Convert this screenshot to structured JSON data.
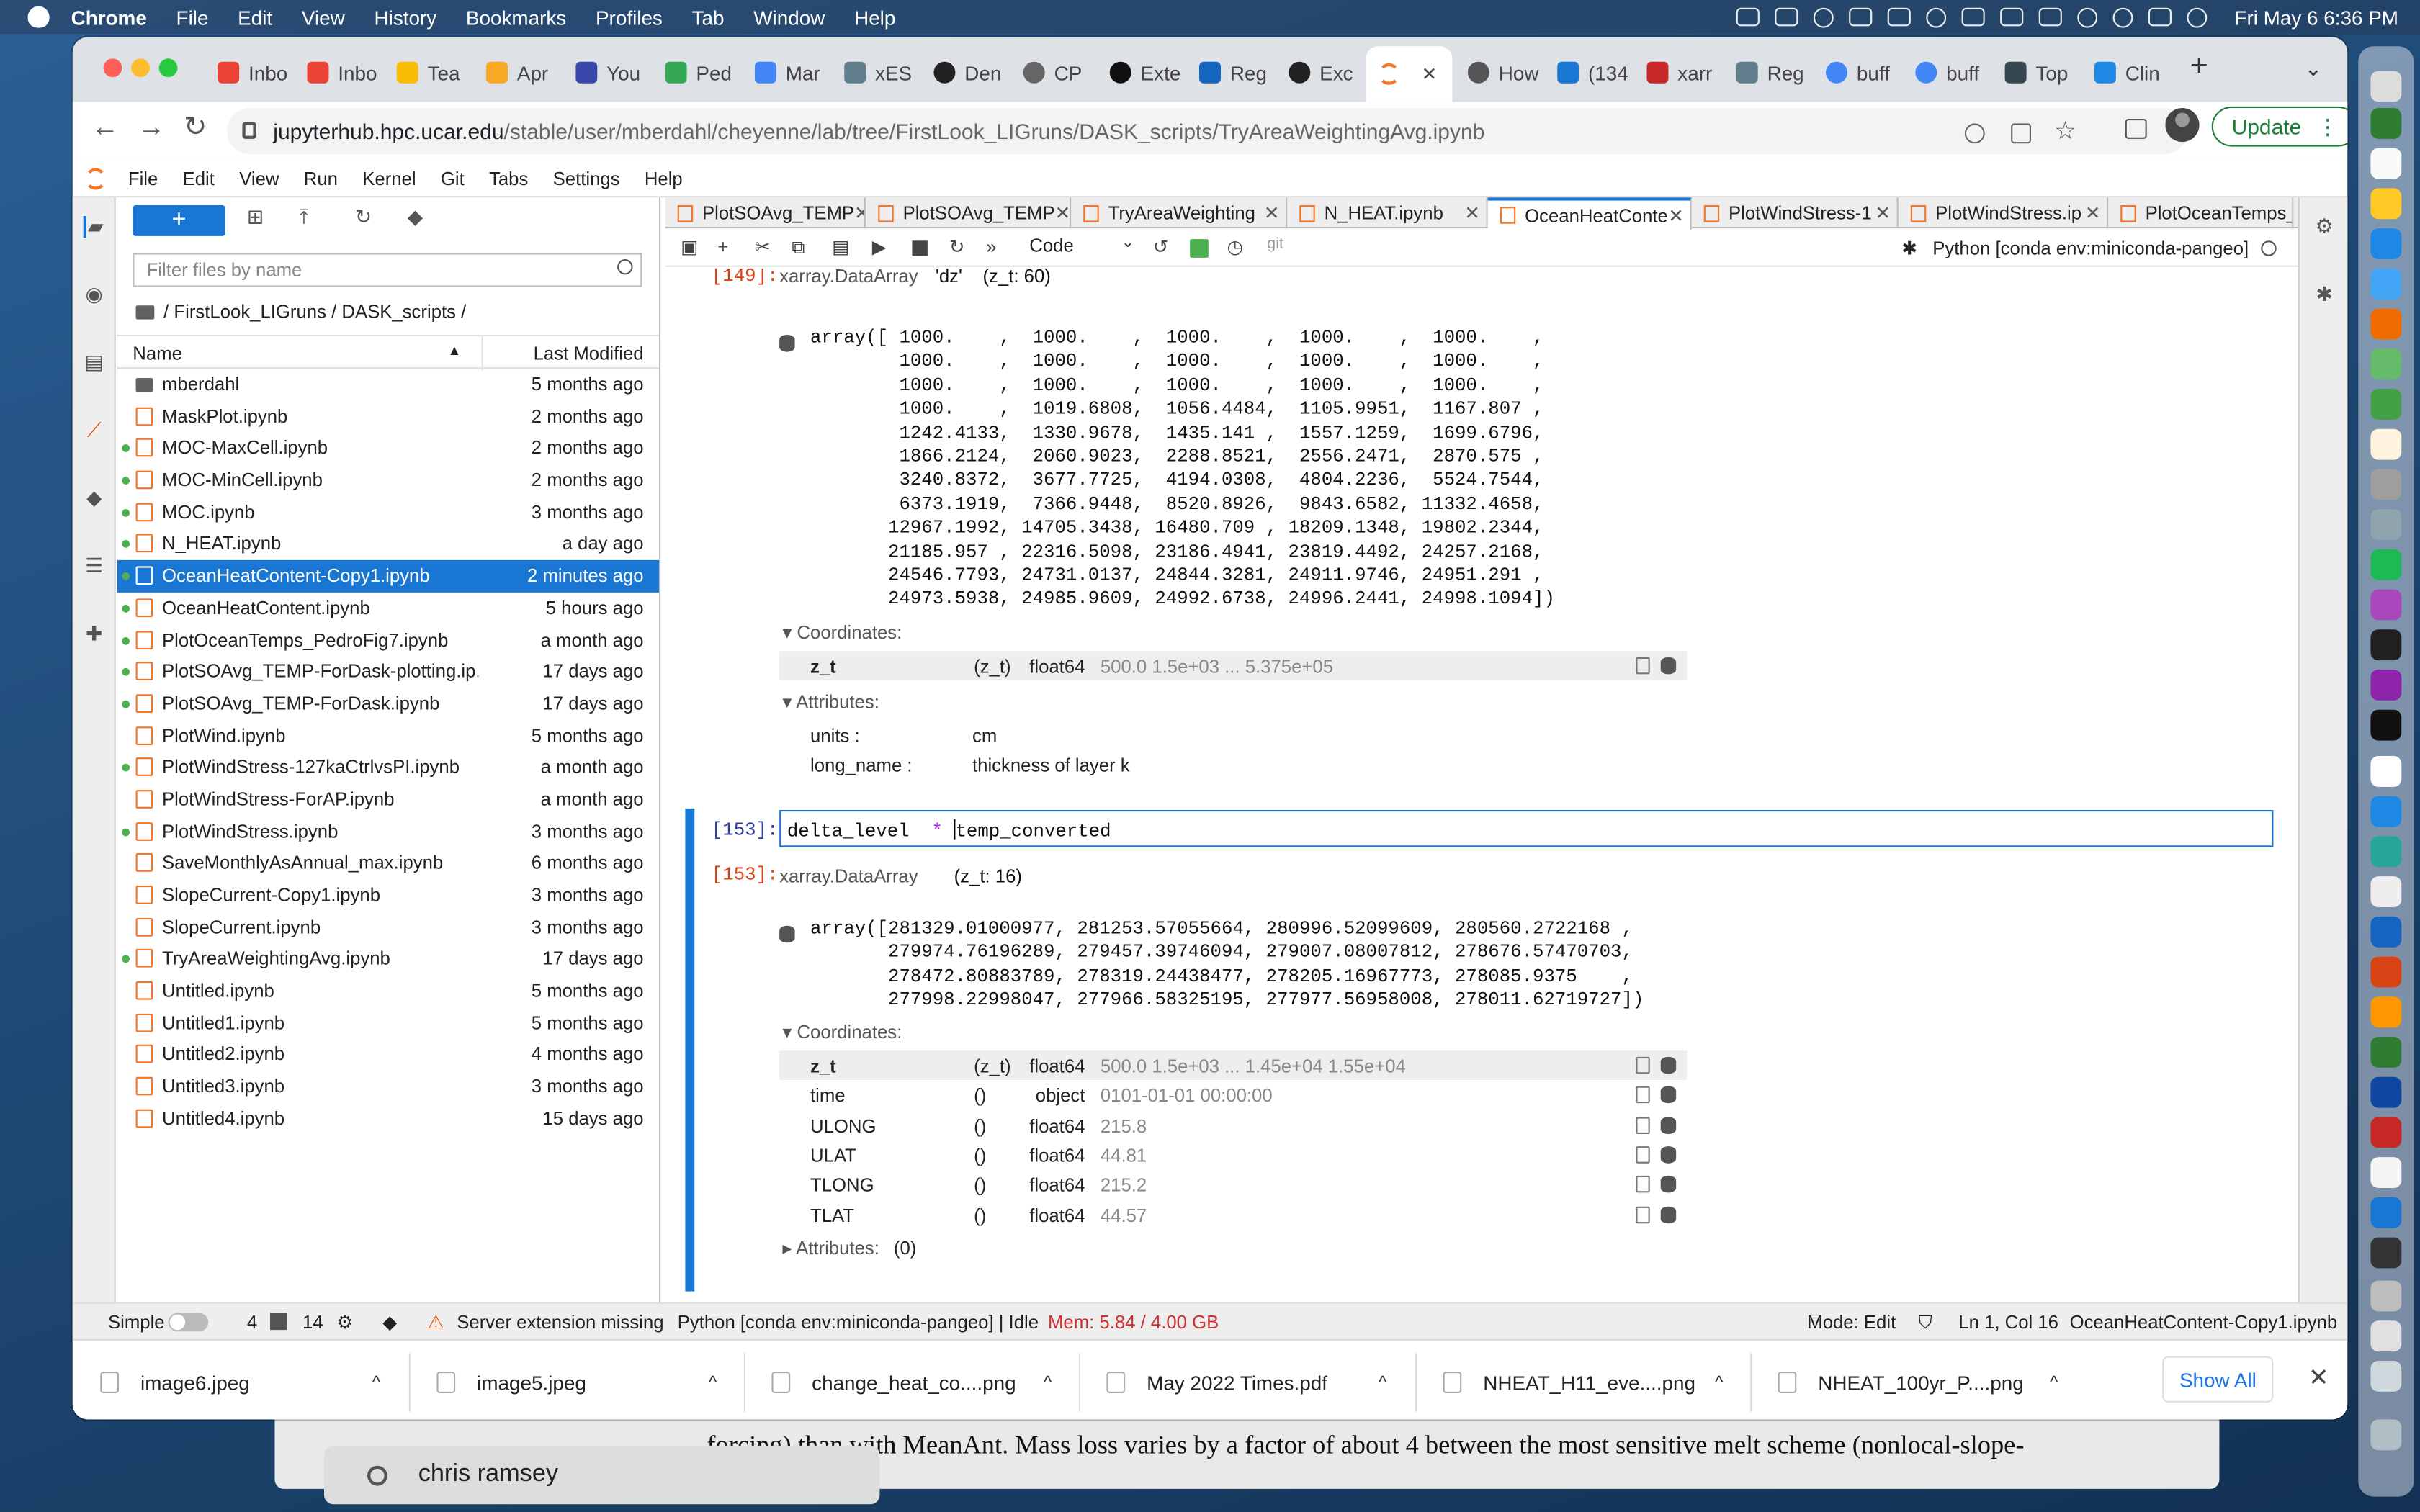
{
  "menubar": {
    "app": "Chrome",
    "items": [
      "File",
      "Edit",
      "View",
      "History",
      "Bookmarks",
      "Profiles",
      "Tab",
      "Window",
      "Help"
    ],
    "clock": "Fri May 6  6:36 PM"
  },
  "browser": {
    "tabs": [
      "Inbo",
      "Inbo",
      "Tea",
      "Apr",
      "You",
      "Ped",
      "Mar",
      "xES",
      "Den",
      "CP",
      "Exte",
      "Reg",
      "Exc",
      "",
      "How",
      "(134",
      "xarr",
      "Reg",
      "buff",
      "buff",
      "Top",
      "Clin"
    ],
    "address_host": "jupyterhub.hpc.ucar.edu",
    "address_path": "/stable/user/mberdahl/cheyenne/lab/tree/FirstLook_LIGruns/DASK_scripts/TryAreaWeightingAvg.ipynb",
    "update_label": "Update"
  },
  "jupyter": {
    "menu": [
      "File",
      "Edit",
      "View",
      "Run",
      "Kernel",
      "Git",
      "Tabs",
      "Settings",
      "Help"
    ],
    "new_label": "+",
    "filter_placeholder": "Filter files by name",
    "breadcrumb": "/ FirstLook_LIGruns / DASK_scripts /",
    "col_name": "Name",
    "col_modified": "Last Modified",
    "files": [
      {
        "name": "mberdahl",
        "modified": "5 months ago",
        "dir": true,
        "running": false
      },
      {
        "name": "MaskPlot.ipynb",
        "modified": "2 months ago",
        "running": false
      },
      {
        "name": "MOC-MaxCell.ipynb",
        "modified": "2 months ago",
        "running": true
      },
      {
        "name": "MOC-MinCell.ipynb",
        "modified": "2 months ago",
        "running": true
      },
      {
        "name": "MOC.ipynb",
        "modified": "3 months ago",
        "running": true
      },
      {
        "name": "N_HEAT.ipynb",
        "modified": "a day ago",
        "running": true
      },
      {
        "name": "OceanHeatContent-Copy1.ipynb",
        "modified": "2 minutes ago",
        "running": true,
        "selected": true
      },
      {
        "name": "OceanHeatContent.ipynb",
        "modified": "5 hours ago",
        "running": true
      },
      {
        "name": "PlotOceanTemps_PedroFig7.ipynb",
        "modified": "a month ago",
        "running": true
      },
      {
        "name": "PlotSOAvg_TEMP-ForDask-plotting.ip...",
        "modified": "17 days ago",
        "running": true
      },
      {
        "name": "PlotSOAvg_TEMP-ForDask.ipynb",
        "modified": "17 days ago",
        "running": true
      },
      {
        "name": "PlotWind.ipynb",
        "modified": "5 months ago",
        "running": false
      },
      {
        "name": "PlotWindStress-127kaCtrlvsPI.ipynb",
        "modified": "a month ago",
        "running": true
      },
      {
        "name": "PlotWindStress-ForAP.ipynb",
        "modified": "a month ago",
        "running": false
      },
      {
        "name": "PlotWindStress.ipynb",
        "modified": "3 months ago",
        "running": true
      },
      {
        "name": "SaveMonthlyAsAnnual_max.ipynb",
        "modified": "6 months ago",
        "running": false
      },
      {
        "name": "SlopeCurrent-Copy1.ipynb",
        "modified": "3 months ago",
        "running": false
      },
      {
        "name": "SlopeCurrent.ipynb",
        "modified": "3 months ago",
        "running": false
      },
      {
        "name": "TryAreaWeightingAvg.ipynb",
        "modified": "17 days ago",
        "running": true
      },
      {
        "name": "Untitled.ipynb",
        "modified": "5 months ago",
        "running": false
      },
      {
        "name": "Untitled1.ipynb",
        "modified": "5 months ago",
        "running": false
      },
      {
        "name": "Untitled2.ipynb",
        "modified": "4 months ago",
        "running": false
      },
      {
        "name": "Untitled3.ipynb",
        "modified": "3 months ago",
        "running": false
      },
      {
        "name": "Untitled4.ipynb",
        "modified": "15 days ago",
        "running": false
      }
    ],
    "doc_tabs": [
      "PlotSOAvg_TEMP",
      "PlotSOAvg_TEMP",
      "TryAreaWeighting",
      "N_HEAT.ipynb",
      "OceanHeatConte",
      "PlotWindStress-1",
      "PlotWindStress.ip",
      "PlotOceanTemps_"
    ],
    "cell_type": "Code",
    "git_label": "git",
    "kernel": "Python [conda env:miniconda-pangeo]"
  },
  "notebook": {
    "out149": {
      "prompt": "[149]:",
      "type": "xarray.DataArray",
      "name": "'dz'",
      "shape": "(z_t: 60)",
      "array": "array([ 1000.    ,  1000.    ,  1000.    ,  1000.    ,  1000.    ,\n        1000.    ,  1000.    ,  1000.    ,  1000.    ,  1000.    ,\n        1000.    ,  1000.    ,  1000.    ,  1000.    ,  1000.    ,\n        1000.    ,  1019.6808,  1056.4484,  1105.9951,  1167.807 ,\n        1242.4133,  1330.9678,  1435.141 ,  1557.1259,  1699.6796,\n        1866.2124,  2060.9023,  2288.8521,  2556.2471,  2870.575 ,\n        3240.8372,  3677.7725,  4194.0308,  4804.2236,  5524.7544,\n        6373.1919,  7366.9448,  8520.8926,  9843.6582, 11332.4658,\n       12967.1992, 14705.3438, 16480.709 , 18209.1348, 19802.2344,\n       21185.957 , 22316.5098, 23186.4941, 23819.4492, 24257.2168,\n       24546.7793, 24731.0137, 24844.3281, 24911.9746, 24951.291 ,\n       24973.5938, 24985.9609, 24992.6738, 24996.2441, 24998.1094])",
      "coords_label": "Coordinates:",
      "coords": [
        {
          "name": "z_t",
          "dims": "(z_t)",
          "dtype": "float64",
          "preview": "500.0 1.5e+03 ... 5.375e+05"
        }
      ],
      "attrs_label": "Attributes:",
      "attrs": [
        {
          "key": "units :",
          "value": "cm"
        },
        {
          "key": "long_name :",
          "value": "thickness of layer k"
        }
      ]
    },
    "in153": {
      "prompt": "[153]:",
      "code_left": "delta_level  ",
      "code_op": "*",
      "code_right": "temp_converted"
    },
    "out153": {
      "prompt": "[153]:",
      "type": "xarray.DataArray",
      "shape": "(z_t: 16)",
      "array": "array([281329.01000977, 281253.57055664, 280996.52099609, 280560.2722168 ,\n       279974.76196289, 279457.39746094, 279007.08007812, 278676.57470703,\n       278472.80883789, 278319.24438477, 278205.16967773, 278085.9375    ,\n       277998.22998047, 277966.58325195, 277977.56958008, 278011.62719727])",
      "coords_label": "Coordinates:",
      "coords": [
        {
          "name": "z_t",
          "dims": "(z_t)",
          "dtype": "float64",
          "preview": "500.0 1.5e+03 ... 1.45e+04 1.55e+04"
        },
        {
          "name": "time",
          "dims": "()",
          "dtype": "object",
          "preview": "0101-01-01 00:00:00"
        },
        {
          "name": "ULONG",
          "dims": "()",
          "dtype": "float64",
          "preview": "215.8"
        },
        {
          "name": "ULAT",
          "dims": "()",
          "dtype": "float64",
          "preview": "44.81"
        },
        {
          "name": "TLONG",
          "dims": "()",
          "dtype": "float64",
          "preview": "215.2"
        },
        {
          "name": "TLAT",
          "dims": "()",
          "dtype": "float64",
          "preview": "44.57"
        }
      ],
      "attrs_label": "Attributes:",
      "attrs_count": "(0)"
    }
  },
  "status": {
    "mode_label": "Simple",
    "n1": "4",
    "n2": "14",
    "server": "Server extension missing",
    "kernel_state": "Python [conda env:miniconda-pangeo] | Idle",
    "mem": "Mem: 5.84 / 4.00 GB",
    "mode": "Mode: Edit",
    "position": "Ln 1, Col 16",
    "file": "OceanHeatContent-Copy1.ipynb"
  },
  "downloads": {
    "items": [
      "image6.jpeg",
      "image5.jpeg",
      "change_heat_co....png",
      "May 2022 Times.pdf",
      "NHEAT_H11_eve....png",
      "NHEAT_100yr_P....png"
    ],
    "show_all": "Show All"
  },
  "background": {
    "doc_text": "forcing) than with MeanAnt. Mass loss varies by a factor of about 4 between the most sensitive melt scheme (nonlocal-slope-",
    "spotlight": "chris ramsey"
  }
}
